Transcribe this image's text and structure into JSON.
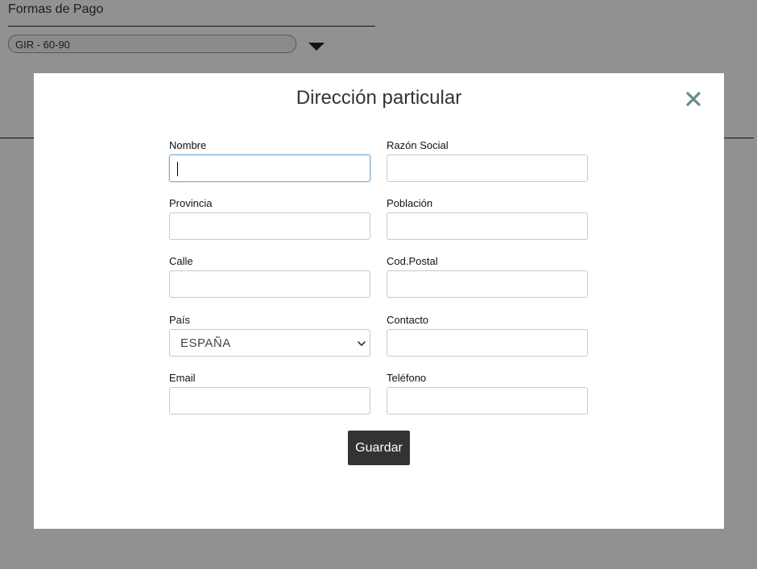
{
  "background": {
    "section_title": "Formas de Pago",
    "payment_select_value": "GIR - 60-90"
  },
  "modal": {
    "title": "Dirección particular",
    "close_icon": "close-icon",
    "fields": {
      "nombre": {
        "label": "Nombre",
        "value": ""
      },
      "razon_social": {
        "label": "Razón Social",
        "value": ""
      },
      "provincia": {
        "label": "Provincia",
        "value": ""
      },
      "poblacion": {
        "label": "Población",
        "value": ""
      },
      "calle": {
        "label": "Calle",
        "value": ""
      },
      "cod_postal": {
        "label": "Cod.Postal",
        "value": ""
      },
      "pais": {
        "label": "País",
        "value": "ESPAÑA"
      },
      "contacto": {
        "label": "Contacto",
        "value": ""
      },
      "email": {
        "label": "Email",
        "value": ""
      },
      "telefono": {
        "label": "Teléfono",
        "value": ""
      }
    },
    "save_label": "Guardar"
  },
  "colors": {
    "overlay": "#000000",
    "close_icon": "#6a8a8a",
    "save_button_bg": "#333333",
    "focus_border": "#7fb1db"
  }
}
